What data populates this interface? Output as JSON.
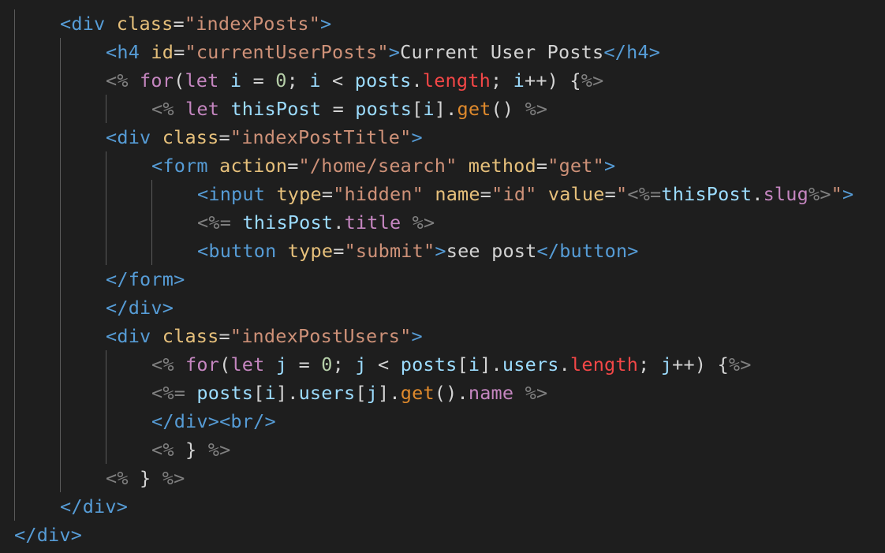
{
  "editor": {
    "language": "ejs",
    "theme": {
      "background": "#1e1e1e",
      "tag": "#569cd6",
      "attribute": "#e6c07b",
      "string": "#ce9178",
      "text": "#d4d4d4",
      "ejs_delimiter": "#808080",
      "keyword": "#c586c0",
      "variable": "#9cdcfe",
      "property": "#f44747",
      "function": "#e08a2c",
      "number": "#b5cea8",
      "indent_guide": "#5a5a5a"
    },
    "lines": [
      {
        "indent": 1,
        "tokens": [
          {
            "t": "tag",
            "v": "<div "
          },
          {
            "t": "attr",
            "v": "class"
          },
          {
            "t": "text",
            "v": "="
          },
          {
            "t": "str",
            "v": "\"indexPosts\""
          },
          {
            "t": "tag",
            "v": ">"
          }
        ]
      },
      {
        "indent": 2,
        "tokens": [
          {
            "t": "tag",
            "v": "<h4 "
          },
          {
            "t": "attr",
            "v": "id"
          },
          {
            "t": "text",
            "v": "="
          },
          {
            "t": "str",
            "v": "\"currentUserPosts\""
          },
          {
            "t": "tag",
            "v": ">"
          },
          {
            "t": "text",
            "v": "Current User Posts"
          },
          {
            "t": "tag",
            "v": "</h4>"
          }
        ]
      },
      {
        "indent": 2,
        "tokens": [
          {
            "t": "ejs",
            "v": "<% "
          },
          {
            "t": "kw",
            "v": "for"
          },
          {
            "t": "punc",
            "v": "("
          },
          {
            "t": "kw",
            "v": "let "
          },
          {
            "t": "var",
            "v": "i"
          },
          {
            "t": "op",
            "v": " = "
          },
          {
            "t": "num",
            "v": "0"
          },
          {
            "t": "punc",
            "v": "; "
          },
          {
            "t": "var",
            "v": "i"
          },
          {
            "t": "op",
            "v": " < "
          },
          {
            "t": "var",
            "v": "posts"
          },
          {
            "t": "punc",
            "v": "."
          },
          {
            "t": "prop",
            "v": "length"
          },
          {
            "t": "punc",
            "v": "; "
          },
          {
            "t": "var",
            "v": "i"
          },
          {
            "t": "op",
            "v": "++"
          },
          {
            "t": "punc",
            "v": ") {"
          },
          {
            "t": "ejs",
            "v": "%>"
          }
        ]
      },
      {
        "indent": 3,
        "tokens": [
          {
            "t": "ejs",
            "v": "<% "
          },
          {
            "t": "kw",
            "v": "let "
          },
          {
            "t": "var",
            "v": "thisPost"
          },
          {
            "t": "op",
            "v": " = "
          },
          {
            "t": "var",
            "v": "posts"
          },
          {
            "t": "punc",
            "v": "["
          },
          {
            "t": "var",
            "v": "i"
          },
          {
            "t": "punc",
            "v": "]."
          },
          {
            "t": "fn",
            "v": "get"
          },
          {
            "t": "punc",
            "v": "() "
          },
          {
            "t": "ejs",
            "v": "%>"
          }
        ]
      },
      {
        "indent": 2,
        "tokens": [
          {
            "t": "tag",
            "v": "<div "
          },
          {
            "t": "attr",
            "v": "class"
          },
          {
            "t": "text",
            "v": "="
          },
          {
            "t": "str",
            "v": "\"indexPostTitle\""
          },
          {
            "t": "tag",
            "v": ">"
          }
        ]
      },
      {
        "indent": 3,
        "tokens": [
          {
            "t": "tag",
            "v": "<form "
          },
          {
            "t": "attr",
            "v": "action"
          },
          {
            "t": "text",
            "v": "="
          },
          {
            "t": "str",
            "v": "\"/home/search\""
          },
          {
            "t": "text",
            "v": " "
          },
          {
            "t": "attr",
            "v": "method"
          },
          {
            "t": "text",
            "v": "="
          },
          {
            "t": "str",
            "v": "\"get\""
          },
          {
            "t": "tag",
            "v": ">"
          }
        ]
      },
      {
        "indent": 4,
        "tokens": [
          {
            "t": "tag",
            "v": "<input "
          },
          {
            "t": "attr",
            "v": "type"
          },
          {
            "t": "text",
            "v": "="
          },
          {
            "t": "str",
            "v": "\"hidden\""
          },
          {
            "t": "text",
            "v": " "
          },
          {
            "t": "attr",
            "v": "name"
          },
          {
            "t": "text",
            "v": "="
          },
          {
            "t": "str",
            "v": "\"id\""
          },
          {
            "t": "text",
            "v": " "
          },
          {
            "t": "attr",
            "v": "value"
          },
          {
            "t": "text",
            "v": "="
          },
          {
            "t": "str",
            "v": "\""
          },
          {
            "t": "ejs",
            "v": "<%="
          },
          {
            "t": "var",
            "v": "thisPost"
          },
          {
            "t": "punc",
            "v": "."
          },
          {
            "t": "eprop",
            "v": "slug"
          },
          {
            "t": "ejs",
            "v": "%>"
          },
          {
            "t": "str",
            "v": "\""
          },
          {
            "t": "tag",
            "v": ">"
          }
        ]
      },
      {
        "indent": 4,
        "tokens": [
          {
            "t": "ejs",
            "v": "<%= "
          },
          {
            "t": "var",
            "v": "thisPost"
          },
          {
            "t": "punc",
            "v": "."
          },
          {
            "t": "eprop",
            "v": "title"
          },
          {
            "t": "text",
            "v": " "
          },
          {
            "t": "ejs",
            "v": "%>"
          }
        ]
      },
      {
        "indent": 4,
        "tokens": [
          {
            "t": "tag",
            "v": "<button "
          },
          {
            "t": "attr",
            "v": "type"
          },
          {
            "t": "text",
            "v": "="
          },
          {
            "t": "str",
            "v": "\"submit\""
          },
          {
            "t": "tag",
            "v": ">"
          },
          {
            "t": "text",
            "v": "see post"
          },
          {
            "t": "tag",
            "v": "</button>"
          }
        ]
      },
      {
        "indent": 2,
        "tokens": [
          {
            "t": "tag",
            "v": "</form>"
          }
        ]
      },
      {
        "indent": 2,
        "tokens": [
          {
            "t": "tag",
            "v": "</div>"
          }
        ]
      },
      {
        "indent": 2,
        "tokens": [
          {
            "t": "tag",
            "v": "<div "
          },
          {
            "t": "attr",
            "v": "class"
          },
          {
            "t": "text",
            "v": "="
          },
          {
            "t": "str",
            "v": "\"indexPostUsers\""
          },
          {
            "t": "tag",
            "v": ">"
          }
        ]
      },
      {
        "indent": 3,
        "tokens": [
          {
            "t": "ejs",
            "v": "<% "
          },
          {
            "t": "kw",
            "v": "for"
          },
          {
            "t": "punc",
            "v": "("
          },
          {
            "t": "kw",
            "v": "let "
          },
          {
            "t": "var",
            "v": "j"
          },
          {
            "t": "op",
            "v": " = "
          },
          {
            "t": "num",
            "v": "0"
          },
          {
            "t": "punc",
            "v": "; "
          },
          {
            "t": "var",
            "v": "j"
          },
          {
            "t": "op",
            "v": " < "
          },
          {
            "t": "var",
            "v": "posts"
          },
          {
            "t": "punc",
            "v": "["
          },
          {
            "t": "var",
            "v": "i"
          },
          {
            "t": "punc",
            "v": "]."
          },
          {
            "t": "var",
            "v": "users"
          },
          {
            "t": "punc",
            "v": "."
          },
          {
            "t": "prop",
            "v": "length"
          },
          {
            "t": "punc",
            "v": "; "
          },
          {
            "t": "var",
            "v": "j"
          },
          {
            "t": "op",
            "v": "++"
          },
          {
            "t": "punc",
            "v": ") {"
          },
          {
            "t": "ejs",
            "v": "%>"
          }
        ]
      },
      {
        "indent": 3,
        "tokens": [
          {
            "t": "ejs",
            "v": "<%= "
          },
          {
            "t": "var",
            "v": "posts"
          },
          {
            "t": "punc",
            "v": "["
          },
          {
            "t": "var",
            "v": "i"
          },
          {
            "t": "punc",
            "v": "]."
          },
          {
            "t": "var",
            "v": "users"
          },
          {
            "t": "punc",
            "v": "["
          },
          {
            "t": "var",
            "v": "j"
          },
          {
            "t": "punc",
            "v": "]."
          },
          {
            "t": "fn",
            "v": "get"
          },
          {
            "t": "punc",
            "v": "()."
          },
          {
            "t": "eprop",
            "v": "name"
          },
          {
            "t": "text",
            "v": " "
          },
          {
            "t": "ejs",
            "v": "%>"
          }
        ]
      },
      {
        "indent": 3,
        "tokens": [
          {
            "t": "tag",
            "v": "</div><br/>"
          }
        ]
      },
      {
        "indent": 3,
        "tokens": [
          {
            "t": "ejs",
            "v": "<% "
          },
          {
            "t": "punc",
            "v": "} "
          },
          {
            "t": "ejs",
            "v": "%>"
          }
        ]
      },
      {
        "indent": 2,
        "tokens": [
          {
            "t": "ejs",
            "v": "<% "
          },
          {
            "t": "punc",
            "v": "} "
          },
          {
            "t": "ejs",
            "v": "%>"
          }
        ]
      },
      {
        "indent": 1,
        "tokens": [
          {
            "t": "tag",
            "v": "</div>"
          }
        ]
      },
      {
        "indent": 0,
        "tokens": [
          {
            "t": "tag",
            "v": "</div>"
          }
        ]
      }
    ]
  }
}
